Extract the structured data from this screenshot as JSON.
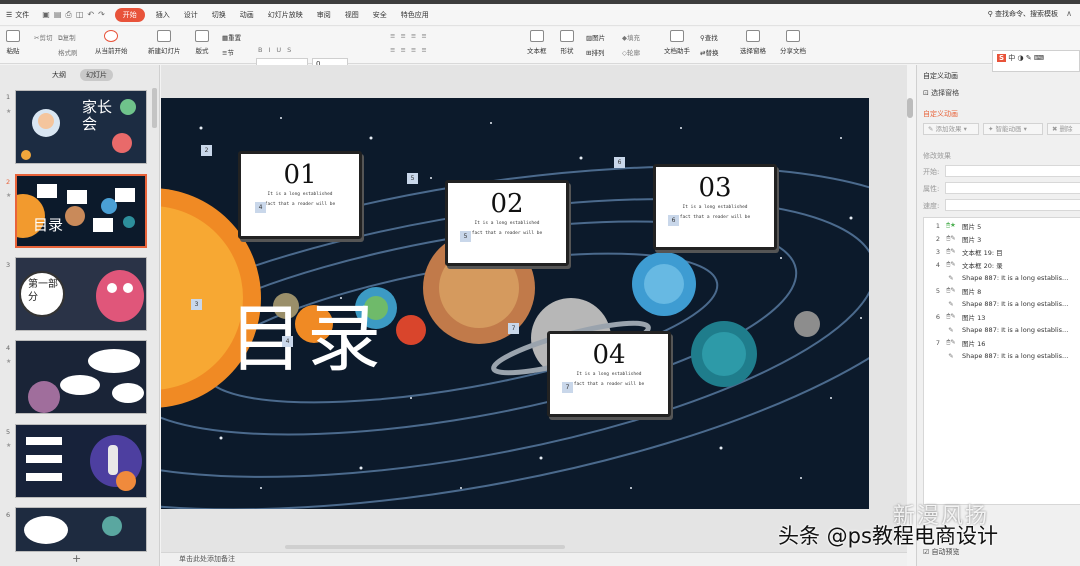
{
  "menubar": {
    "file": "文件",
    "tabs": [
      "开始",
      "插入",
      "设计",
      "切换",
      "动画",
      "幻灯片放映",
      "审阅",
      "视图",
      "安全",
      "特色应用"
    ],
    "active": "开始",
    "search": "查找命令、搜索模板"
  },
  "ribbon": {
    "paste": "粘贴",
    "cut": "剪切",
    "copy": "复制",
    "format_painter": "格式刷",
    "play_from_current": "从当前开始",
    "new_slide": "新建幻灯片",
    "layout": "版式",
    "reset": "重置",
    "section": "节",
    "font_size": "0",
    "textbox": "文本框",
    "shape": "形状",
    "image": "图片",
    "arrange": "排列",
    "fill": "填充",
    "outline": "轮廓",
    "doc_helper": "文档助手",
    "find": "查找",
    "replace": "替换",
    "select_pane": "选择窗格",
    "share": "分享文档"
  },
  "left": {
    "tabs": [
      "大纲",
      "幻灯片"
    ],
    "slide_numbers": [
      "1",
      "2",
      "3",
      "4",
      "5",
      "6"
    ],
    "thumb1_title": "家长会",
    "thumb2_title": "目录",
    "thumb3_title": "第一部分",
    "add": "+"
  },
  "slide": {
    "title": "目录",
    "cards": [
      {
        "num": "01",
        "line1": "It is a long established",
        "line2": "fact that a reader will be",
        "tag": "4"
      },
      {
        "num": "02",
        "line1": "It is a long established",
        "line2": "fact that a reader will be",
        "tag": "5"
      },
      {
        "num": "03",
        "line1": "It is a long established",
        "line2": "fact that a reader will be",
        "tag": "6"
      },
      {
        "num": "04",
        "line1": "It is a long established",
        "line2": "fact that a reader will be",
        "tag": "7"
      }
    ],
    "tags": [
      "2",
      "3",
      "4",
      "5",
      "6",
      "7"
    ]
  },
  "notes": "单击此处添加备注",
  "rightpane": {
    "title": "自定义动画",
    "select_pane": "选择窗格",
    "section": "自定义动画",
    "add_effect": "添加效果",
    "smart_anim": "智能动画",
    "delete": "删除",
    "modify": "修改效果",
    "start": "开始:",
    "property": "属性:",
    "speed": "速度:",
    "auto_preview": "自动预览",
    "items": [
      {
        "n": "1",
        "label": "图片 5"
      },
      {
        "n": "2",
        "label": "图片 3"
      },
      {
        "n": "3",
        "label": "文本框 19: 目"
      },
      {
        "n": "4",
        "label": "文本框 20: 录"
      },
      {
        "n": "",
        "label": "Shape 887: It is a long establis..."
      },
      {
        "n": "5",
        "label": "图片 8"
      },
      {
        "n": "",
        "label": "Shape 887: It is a long establis..."
      },
      {
        "n": "6",
        "label": "图片 13"
      },
      {
        "n": "",
        "label": "Shape 887: It is a long establis..."
      },
      {
        "n": "7",
        "label": "图片 16"
      },
      {
        "n": "",
        "label": "Shape 887: It is a long establis..."
      }
    ]
  },
  "floattoolbar": {
    "text": "中"
  },
  "watermark": {
    "logo": "新漫风扬",
    "caption": "头条 @ps教程电商设计"
  }
}
